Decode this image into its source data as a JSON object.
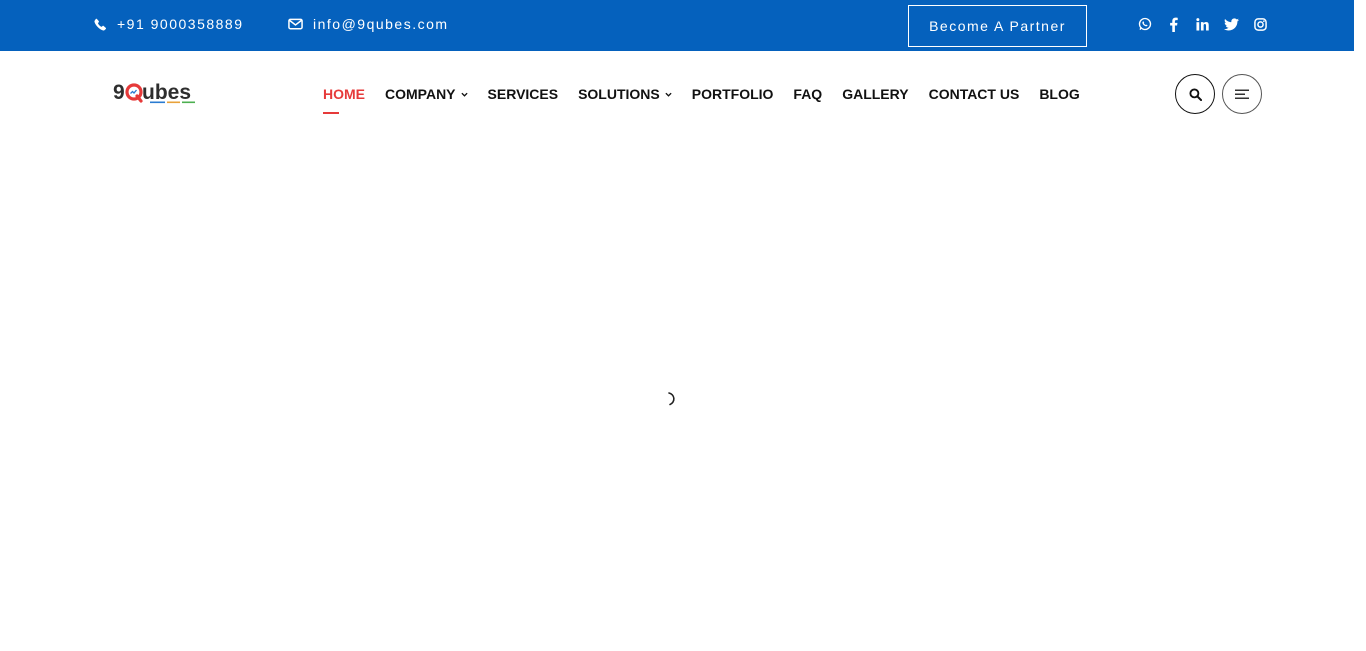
{
  "topbar": {
    "phone": "+91 9000358889",
    "email": "info@9qubes.com",
    "partner_label": "Become A Partner",
    "socials": [
      "whatsapp-icon",
      "facebook-icon",
      "linkedin-icon",
      "twitter-icon",
      "instagram-icon"
    ],
    "bg_color": "#0561bd"
  },
  "header": {
    "logo_text": "9Qubes",
    "logo_tagline": "Innovate. Digitize. Thrive.",
    "nav": [
      {
        "label": "HOME",
        "active": true,
        "dropdown": false
      },
      {
        "label": "COMPANY",
        "active": false,
        "dropdown": true
      },
      {
        "label": "SERVICES",
        "active": false,
        "dropdown": false
      },
      {
        "label": "SOLUTIONS",
        "active": false,
        "dropdown": true
      },
      {
        "label": "PORTFOLIO",
        "active": false,
        "dropdown": false
      },
      {
        "label": "FAQ",
        "active": false,
        "dropdown": false
      },
      {
        "label": "GALLERY",
        "active": false,
        "dropdown": false
      },
      {
        "label": "CONTACT US",
        "active": false,
        "dropdown": false
      },
      {
        "label": "BLOG",
        "active": false,
        "dropdown": false
      }
    ],
    "active_color": "#e63a3a"
  }
}
